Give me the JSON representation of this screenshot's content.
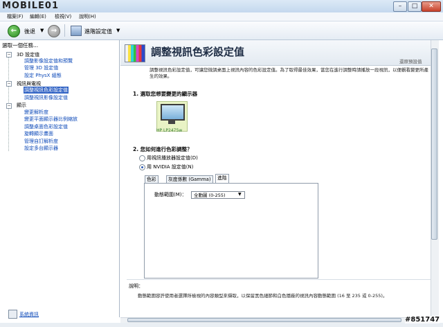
{
  "window": {
    "logo_text": "MOBILE01",
    "min": "–",
    "max": "□",
    "close": "✕"
  },
  "menu": [
    "檔案(F)",
    "編輯(E)",
    "檢視(V)",
    "說明(H)"
  ],
  "toolbar": {
    "back_label": "後退",
    "home_label": "進階設定值"
  },
  "left": {
    "header": "選取一個任務...",
    "tree": [
      {
        "label": "3D 設定值",
        "kind": "cat"
      },
      {
        "label": "調整影像設定值和預覽",
        "kind": "link"
      },
      {
        "label": "管理 3D 設定值",
        "kind": "link"
      },
      {
        "label": "設定 PhysX 組態",
        "kind": "link"
      },
      {
        "label": "視訊與電視",
        "kind": "cat"
      },
      {
        "label": "調整視訊色彩設定值",
        "kind": "sel"
      },
      {
        "label": "調整視訊影像設定值",
        "kind": "link"
      },
      {
        "label": "顯示",
        "kind": "cat"
      },
      {
        "label": "變更解析度",
        "kind": "link"
      },
      {
        "label": "變更平面顯示器比例縮放",
        "kind": "link"
      },
      {
        "label": "調整桌面色彩設定值",
        "kind": "link"
      },
      {
        "label": "旋轉顯示畫面",
        "kind": "link"
      },
      {
        "label": "管理自訂解析度",
        "kind": "link"
      },
      {
        "label": "設定多台顯示器",
        "kind": "link"
      }
    ],
    "system_info": "系統資訊"
  },
  "main": {
    "title": "調整視訊色彩設定值",
    "restore": "還原預設值",
    "description": "調整視訊色彩設定值，可讓您微調桌面上視訊內容的色彩設定值。為了取得最佳效果，當您在進行調整時請播放一段視訊，以便觀看變更所產生的效果。",
    "q1": "1. 選取您想要變更的顯示器",
    "monitor_label": "HP LP2475w",
    "q2": "2. 您如何進行色彩調整？",
    "opt1": "用視訊播放器設定值(D)",
    "opt2": "用 NVIDIA 設定值(N)",
    "tabs": [
      "色彩",
      "灰度係數 (Gamma)",
      "進階"
    ],
    "dynamic_range_label": "動態範圍(M)：",
    "dynamic_range_value": "全動圖 (0-255)",
    "desc_title": "說明：",
    "desc_text": "動態範圍容許使用者選擇所檢視的內容類型來擷取，以保留黑色細節和白色隱蔽的視訊內容動態範圍 (16 至 235 或 0-255)。"
  },
  "watermark": "#851747"
}
